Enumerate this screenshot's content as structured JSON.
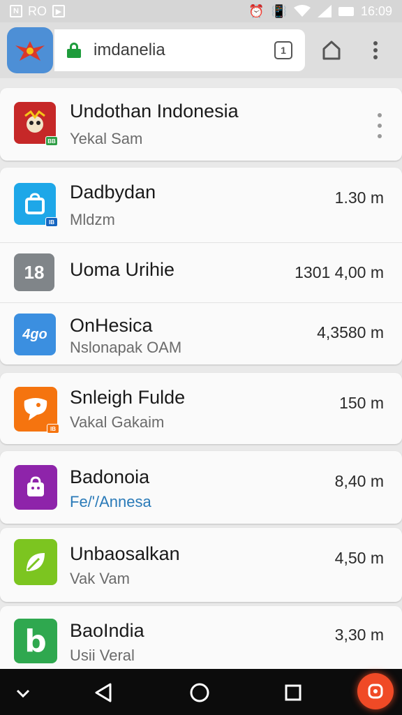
{
  "status_bar": {
    "left_text": "RO",
    "time": "16:09"
  },
  "browser": {
    "url": "imdanelia",
    "tab_count": "1"
  },
  "items": [
    {
      "title": "Undothan Indonesia",
      "subtitle": "Yekal Sam",
      "size": "",
      "badge": "BB",
      "icon_color": "#c62828",
      "icon_glyph": ""
    },
    {
      "title": "Dadbydan",
      "subtitle": "Mldzm",
      "size": "1.30 m",
      "badge": "IB",
      "icon_color": "#1ea7e8",
      "icon_glyph": ""
    },
    {
      "title": "Uoma Urihie",
      "subtitle": "",
      "size": "1301 4,00 m",
      "badge": "",
      "icon_color": "#808589",
      "icon_glyph": "18"
    },
    {
      "title": "OnHesica",
      "subtitle": "Nslonapak OAM",
      "size": "4,3580 m",
      "badge": "",
      "icon_color": "#3b8fe0",
      "icon_glyph": "4go"
    },
    {
      "title": "Snleigh Fulde",
      "subtitle": "Vakal Gakaim",
      "size": "150 m",
      "badge": "IB",
      "icon_color": "#f5740f",
      "icon_glyph": ""
    },
    {
      "title": "Badonoia",
      "subtitle": "Fe/'/Annesa",
      "size": "8,40 m",
      "badge": "",
      "icon_color": "#8e24aa",
      "icon_glyph": ""
    },
    {
      "title": "Unbaosalkan",
      "subtitle": "Vak Vam",
      "size": "4,50 m",
      "badge": "",
      "icon_color": "#7cc520",
      "icon_glyph": ""
    },
    {
      "title": "BaoIndia",
      "subtitle": "Usii Veral",
      "size": "3,30 m",
      "badge": "",
      "icon_color": "#2fa84f",
      "icon_glyph": "b"
    }
  ],
  "colors": {
    "accent_green": "#1e9c3c",
    "nav_record": "#f04a26",
    "link_subtitle": "#2a7ab8"
  }
}
